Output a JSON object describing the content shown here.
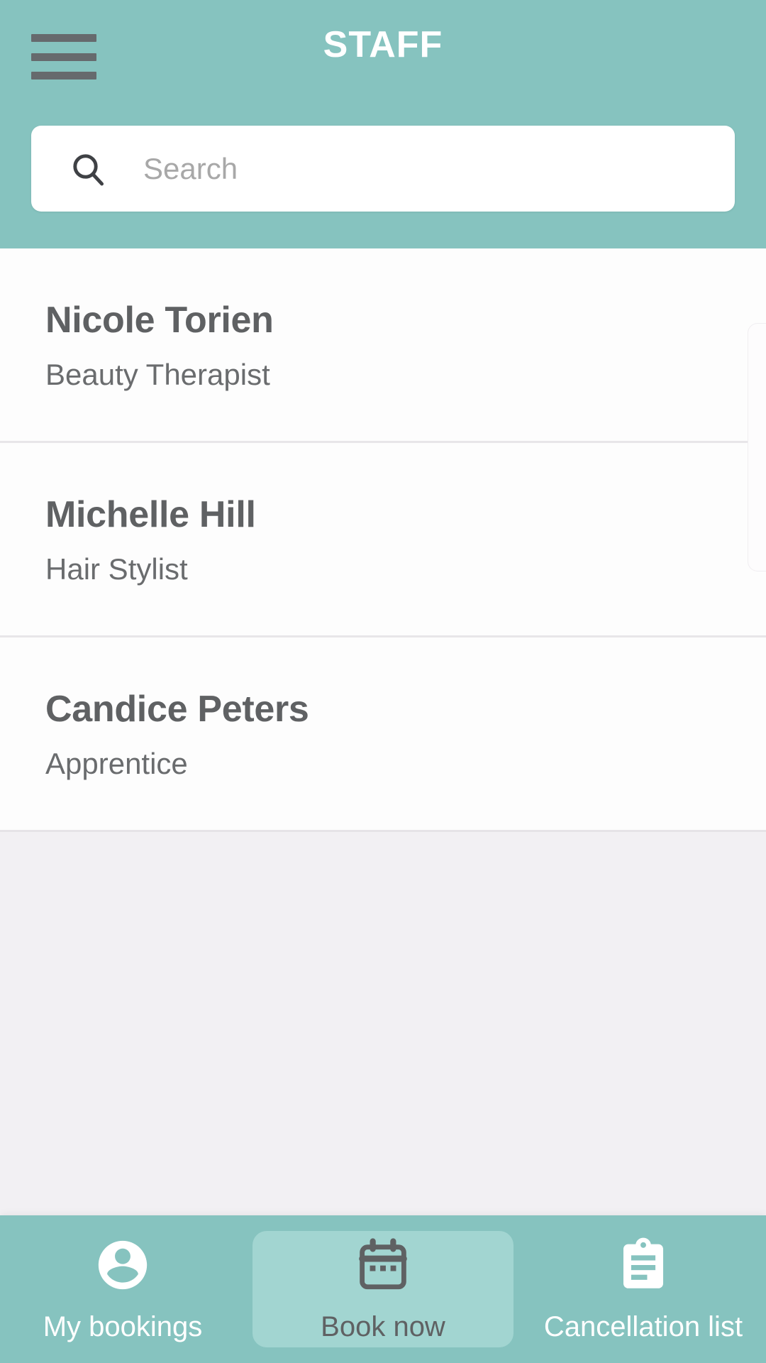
{
  "header": {
    "title": "STAFF",
    "menu_icon": "hamburger-menu-icon",
    "background_color": "#86c3bf"
  },
  "search": {
    "placeholder": "Search",
    "value": "",
    "icon": "search-icon"
  },
  "staff_list": [
    {
      "name": "Nicole Torien",
      "role": "Beauty Therapist"
    },
    {
      "name": "Michelle Hill",
      "role": "Hair Stylist"
    },
    {
      "name": "Candice Peters",
      "role": "Apprentice"
    }
  ],
  "bottom_nav": {
    "active_index": 1,
    "items": [
      {
        "label": "My bookings",
        "icon": "account-circle-icon",
        "active": false
      },
      {
        "label": "Book now",
        "icon": "calendar-icon",
        "active": true
      },
      {
        "label": "Cancellation list",
        "icon": "clipboard-list-icon",
        "active": false
      }
    ],
    "background_color": "#86c3bf",
    "active_background_color": "#a2d5d1"
  },
  "colors": {
    "accent": "#86c3bf",
    "accent_light": "#a2d5d1",
    "text_primary": "#5f6163",
    "text_secondary": "#6a6c6e",
    "page_background": "#f2f0f3",
    "list_background": "#fdfdfd"
  }
}
